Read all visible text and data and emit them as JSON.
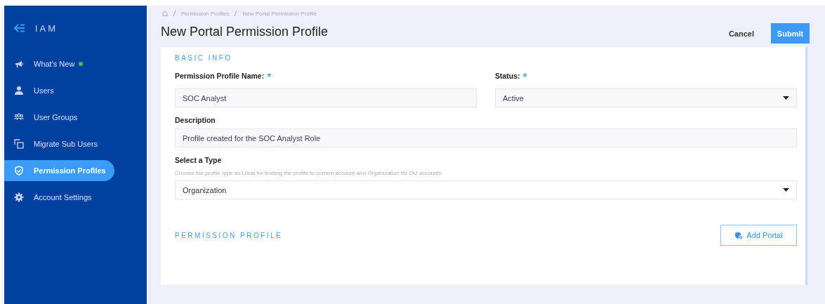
{
  "sidebar": {
    "title": "IAM",
    "items": [
      {
        "label": "What's New",
        "selected": false,
        "color": "#2ecc40"
      },
      {
        "label": "Users",
        "selected": false
      },
      {
        "label": "User Groups",
        "selected": false
      },
      {
        "label": "Migrate Sub Users",
        "selected": false
      },
      {
        "label": "Permission Profiles",
        "selected": true
      },
      {
        "label": "Account Settings",
        "selected": false
      }
    ]
  },
  "breadcrumb": [
    "Permission Profiles",
    "New Portal Permission Profile"
  ],
  "page_title": "New Portal Permission Profile",
  "actions": {
    "cancel": "Cancel",
    "submit": "Submit"
  },
  "basic_info": {
    "heading": "BASIC INFO",
    "name_field": {
      "label": "Permission Profile Name:",
      "required_mark": "*",
      "value": "SOC Analyst"
    },
    "status_field": {
      "label": "Status:",
      "required_mark": "*",
      "value": "Active"
    },
    "description_field": {
      "label": "Description",
      "value": "Profile created for the SOC Analyst Role"
    },
    "type_field": {
      "label": "Select a Type",
      "hint": "Choose the profile type as Local for limiting the profile to current account and Organization for OU accounts",
      "value": "Organization"
    }
  },
  "permission_profile": {
    "heading": "PERMISSION PROFILE",
    "add_button": "Add Portal"
  }
}
